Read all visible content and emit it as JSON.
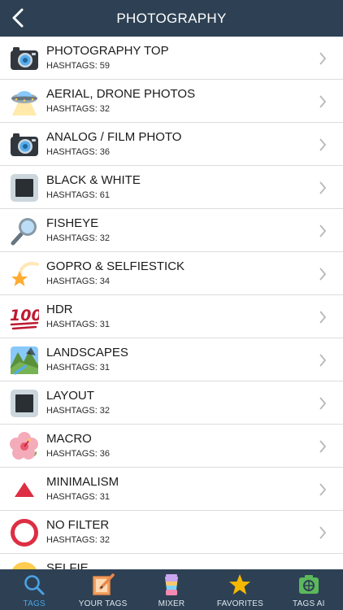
{
  "header": {
    "title": "PHOTOGRAPHY",
    "back_icon": "chevron-left-icon"
  },
  "categories": [
    {
      "name": "PHOTOGRAPHY TOP",
      "count": "HASHTAGS: 59",
      "icon": "camera-icon"
    },
    {
      "name": "AERIAL, DRONE PHOTOS",
      "count": "HASHTAGS: 32",
      "icon": "ufo-icon"
    },
    {
      "name": "ANALOG / FILM PHOTO",
      "count": "HASHTAGS: 36",
      "icon": "camera-icon"
    },
    {
      "name": "BLACK & WHITE",
      "count": "HASHTAGS: 61",
      "icon": "black-square-icon"
    },
    {
      "name": "FISHEYE",
      "count": "HASHTAGS: 32",
      "icon": "magnifier-icon"
    },
    {
      "name": "GOPRO & SELFIESTICK",
      "count": "HASHTAGS: 34",
      "icon": "shooting-star-icon"
    },
    {
      "name": "HDR",
      "count": "HASHTAGS: 31",
      "icon": "hundred-points-icon"
    },
    {
      "name": "LANDSCAPES",
      "count": "HASHTAGS: 31",
      "icon": "landscape-icon"
    },
    {
      "name": "LAYOUT",
      "count": "HASHTAGS: 32",
      "icon": "black-square-icon"
    },
    {
      "name": "MACRO",
      "count": "HASHTAGS: 36",
      "icon": "hibiscus-icon"
    },
    {
      "name": "MINIMALISM",
      "count": "HASHTAGS: 31",
      "icon": "red-triangle-icon"
    },
    {
      "name": "NO FILTER",
      "count": "HASHTAGS: 32",
      "icon": "red-circle-icon"
    },
    {
      "name": "SELFIE",
      "count": "",
      "icon": "face-icon"
    }
  ],
  "tabbar": {
    "tabs": [
      {
        "label": "TAGS",
        "icon": "search-icon",
        "active": true
      },
      {
        "label": "YOUR TAGS",
        "icon": "edit-icon",
        "active": false
      },
      {
        "label": "MIXER",
        "icon": "blender-icon",
        "active": false
      },
      {
        "label": "FAVORITES",
        "icon": "star-icon",
        "active": false
      },
      {
        "label": "TAGS AI",
        "icon": "camera-ai-icon",
        "active": false
      }
    ]
  },
  "colors": {
    "bar": "#2e4154",
    "active": "#4aa3e6",
    "divider": "#dcdcdc"
  }
}
